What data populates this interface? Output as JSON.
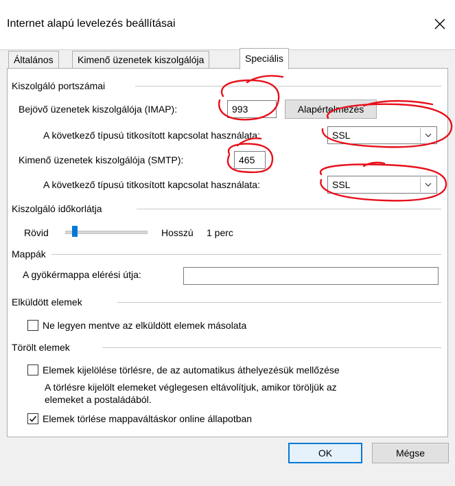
{
  "window": {
    "title": "Internet alapú levelezés beállításai"
  },
  "tabs": [
    {
      "label": "Általános"
    },
    {
      "label": "Kimenő üzenetek kiszolgálója"
    },
    {
      "label": "Speciális"
    }
  ],
  "server_ports": {
    "group_title": "Kiszolgáló portszámai",
    "incoming_label": "Bejövő üzenetek kiszolgálója (IMAP):",
    "incoming_value": "993",
    "default_button": "Alapértelmezés",
    "enc_label_1": "A következő típusú titkosított kapcsolat használata:",
    "enc_value_1": "SSL",
    "outgoing_label": "Kimenő üzenetek kiszolgálója (SMTP):",
    "outgoing_value": "465",
    "enc_label_2": "A következő típusú titkosított kapcsolat használata:",
    "enc_value_2": "SSL"
  },
  "timeout": {
    "group_title": "Kiszolgáló időkorlátja",
    "short_label": "Rövid",
    "long_label": "Hosszú",
    "value": "1 perc",
    "slider_position": 0.12
  },
  "folders": {
    "group_title": "Mappák",
    "root_path_label": "A gyökérmappa elérési útja:",
    "root_path_value": ""
  },
  "sent_items": {
    "group_title": "Elküldött elemek",
    "no_copy_label": "Ne legyen mentve az elküldött elemek másolata",
    "no_copy_checked": false
  },
  "deleted_items": {
    "group_title": "Törölt elemek",
    "mark_label": "Elemek kijelölése törlésre, de az automatikus áthelyezésük mellőzése",
    "mark_checked": false,
    "note_line1": "A törlésre kijelölt elemeket véglegesen eltávolítjuk, amikor töröljük az",
    "note_line2": "elemeket a postaládából.",
    "purge_label": "Elemek törlése mappaváltáskor online állapotban",
    "purge_checked": true
  },
  "footer": {
    "ok": "OK",
    "cancel": "Mégse"
  },
  "colors": {
    "accent": "#0078d7",
    "annotation": "#e8101a"
  }
}
